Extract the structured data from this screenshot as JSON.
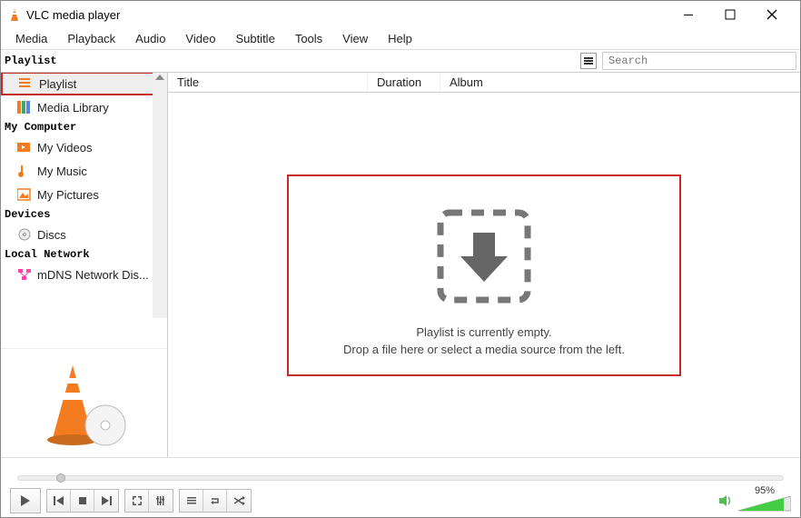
{
  "window": {
    "title": "VLC media player"
  },
  "menu": [
    "Media",
    "Playback",
    "Audio",
    "Video",
    "Subtitle",
    "Tools",
    "View",
    "Help"
  ],
  "sidebar": {
    "top_label": "Playlist",
    "sections": [
      {
        "items": [
          {
            "label": "Playlist",
            "icon": "playlist-icon",
            "selected": true,
            "highlight": true
          },
          {
            "label": "Media Library",
            "icon": "media-library-icon"
          }
        ]
      },
      {
        "header": "My Computer",
        "items": [
          {
            "label": "My Videos",
            "icon": "videos-icon"
          },
          {
            "label": "My Music",
            "icon": "music-icon"
          },
          {
            "label": "My Pictures",
            "icon": "pictures-icon"
          }
        ]
      },
      {
        "header": "Devices",
        "items": [
          {
            "label": "Discs",
            "icon": "disc-icon"
          }
        ]
      },
      {
        "header": "Local Network",
        "items": [
          {
            "label": "mDNS Network Dis...",
            "icon": "network-icon"
          }
        ]
      }
    ]
  },
  "search": {
    "placeholder": "Search"
  },
  "columns": {
    "title": "Title",
    "duration": "Duration",
    "album": "Album"
  },
  "drop": {
    "line1": "Playlist is currently empty.",
    "line2": "Drop a file here or select a media source from the left."
  },
  "volume": {
    "percent": "95%"
  }
}
